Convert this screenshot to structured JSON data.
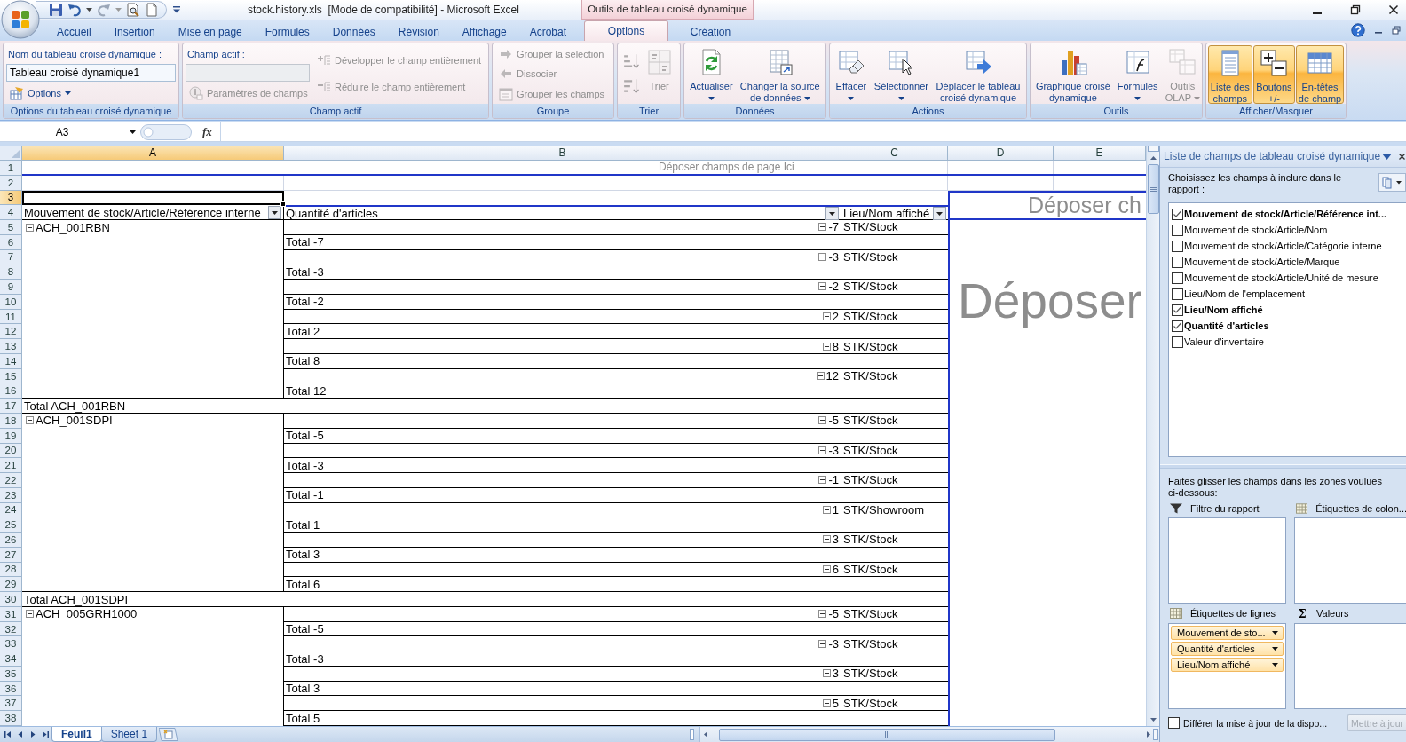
{
  "title_bar": {
    "title": "stock.history.xls  [Mode de compatibilité] - Microsoft Excel"
  },
  "ribbon_tabs": [
    {
      "label": "Accueil",
      "selected": false
    },
    {
      "label": "Insertion",
      "selected": false
    },
    {
      "label": "Mise en page",
      "selected": false
    },
    {
      "label": "Formules",
      "selected": false
    },
    {
      "label": "Données",
      "selected": false
    },
    {
      "label": "Révision",
      "selected": false
    },
    {
      "label": "Affichage",
      "selected": false
    },
    {
      "label": "Acrobat",
      "selected": false
    }
  ],
  "contextual_tabs": {
    "header": "Outils de tableau croisé dynamique",
    "tabs": [
      {
        "label": "Options",
        "selected": true
      },
      {
        "label": "Création",
        "selected": false
      }
    ]
  },
  "ribbon_groups": [
    {
      "label": "Options du tableau croisé dynamique",
      "columns": [
        [
          {
            "kind": "caption",
            "text": "Nom du tableau croisé dynamique :"
          },
          {
            "kind": "field",
            "value": "Tableau croisé dynamique1",
            "disabled": false
          },
          {
            "kind": "small",
            "label": "Options",
            "menu": true,
            "disabled": false
          }
        ]
      ]
    },
    {
      "label": "Champ actif",
      "columns": [
        [
          {
            "kind": "caption",
            "text": "Champ actif :"
          },
          {
            "kind": "field",
            "disabled": true
          },
          {
            "kind": "small",
            "label": "Paramètres de champs",
            "disabled": true
          }
        ],
        [
          {
            "kind": "small",
            "label": "Développer le champ entièrement",
            "disabled": true
          },
          {
            "kind": "small",
            "label": "Réduire le champ entièrement",
            "disabled": true
          }
        ]
      ]
    },
    {
      "label": "Groupe",
      "columns": [
        [
          {
            "kind": "small",
            "label": "Grouper la sélection",
            "disabled": true
          },
          {
            "kind": "small",
            "label": "Dissocier",
            "disabled": true
          },
          {
            "kind": "small",
            "label": "Grouper les champs",
            "disabled": true
          }
        ]
      ]
    },
    {
      "label": "Trier",
      "columns": [
        [
          {
            "kind": "icon",
            "disabled": true
          },
          {
            "kind": "icon",
            "disabled": true
          }
        ],
        [
          {
            "kind": "large",
            "label": "Trier",
            "disabled": true
          }
        ]
      ]
    },
    {
      "label": "Données",
      "columns": [
        [
          {
            "kind": "large",
            "label": "Actualiser",
            "menu": true,
            "disabled": false
          }
        ],
        [
          {
            "kind": "large",
            "label": "Changer la source\nde données",
            "menu": true,
            "disabled": false
          }
        ]
      ]
    },
    {
      "label": "Actions",
      "columns": [
        [
          {
            "kind": "large",
            "label": "Effacer",
            "menu": true,
            "disabled": false
          }
        ],
        [
          {
            "kind": "large",
            "label": "Sélectionner",
            "menu": true,
            "disabled": false
          }
        ],
        [
          {
            "kind": "large",
            "label": "Déplacer le tableau\ncroisé dynamique",
            "disabled": false
          }
        ]
      ]
    },
    {
      "label": "Outils",
      "columns": [
        [
          {
            "kind": "large",
            "label": "Graphique croisé\ndynamique",
            "disabled": false
          }
        ],
        [
          {
            "kind": "large",
            "label": "Formules",
            "menu": true,
            "disabled": false
          }
        ],
        [
          {
            "kind": "large",
            "label": "Outils\nOLAP",
            "menu": true,
            "disabled": true
          }
        ]
      ]
    },
    {
      "label": "Afficher/Masquer",
      "columns": [
        [
          {
            "kind": "toggle",
            "label": "Liste des\nchamps",
            "on": true
          }
        ],
        [
          {
            "kind": "toggle",
            "label": "Boutons\n+/-",
            "on": true
          }
        ],
        [
          {
            "kind": "toggle",
            "label": "En-têtes\nde champ",
            "on": true
          }
        ]
      ]
    }
  ],
  "formula_bar": {
    "name_box": "A3",
    "function_button": "fx"
  },
  "sheet": {
    "columns": [
      {
        "label": "A",
        "selected": true
      },
      {
        "label": "B",
        "selected": false
      },
      {
        "label": "C",
        "selected": false
      },
      {
        "label": "D",
        "selected": false
      },
      {
        "label": "E",
        "selected": false
      }
    ],
    "row_numbers": [
      {
        "label": "1",
        "selected": false
      },
      {
        "label": "2",
        "selected": false
      },
      {
        "label": "3",
        "selected": true
      },
      {
        "label": "4",
        "selected": false
      },
      {
        "label": "5",
        "selected": false
      },
      {
        "label": "6",
        "selected": false
      },
      {
        "label": "7",
        "selected": false
      },
      {
        "label": "8",
        "selected": false
      },
      {
        "label": "9",
        "selected": false
      },
      {
        "label": "10",
        "selected": false
      },
      {
        "label": "11",
        "selected": false
      },
      {
        "label": "12",
        "selected": false
      },
      {
        "label": "13",
        "selected": false
      },
      {
        "label": "14",
        "selected": false
      },
      {
        "label": "15",
        "selected": false
      },
      {
        "label": "16",
        "selected": false
      },
      {
        "label": "17",
        "selected": false
      },
      {
        "label": "18",
        "selected": false
      },
      {
        "label": "19",
        "selected": false
      },
      {
        "label": "20",
        "selected": false
      },
      {
        "label": "21",
        "selected": false
      },
      {
        "label": "22",
        "selected": false
      },
      {
        "label": "23",
        "selected": false
      },
      {
        "label": "24",
        "selected": false
      },
      {
        "label": "25",
        "selected": false
      },
      {
        "label": "26",
        "selected": false
      },
      {
        "label": "27",
        "selected": false
      },
      {
        "label": "28",
        "selected": false
      },
      {
        "label": "29",
        "selected": false
      },
      {
        "label": "30",
        "selected": false
      },
      {
        "label": "31",
        "selected": false
      },
      {
        "label": "32",
        "selected": false
      },
      {
        "label": "33",
        "selected": false
      },
      {
        "label": "34",
        "selected": false
      },
      {
        "label": "35",
        "selected": false
      },
      {
        "label": "36",
        "selected": false
      },
      {
        "label": "37",
        "selected": false
      },
      {
        "label": "38",
        "selected": false
      }
    ],
    "page_drop_zone": "Déposer champs de page Ici",
    "column_drop_zone": "Déposer ch",
    "data_drop_zone": "Déposer",
    "pivot": {
      "headers": [
        "Mouvement de stock/Article/Référence interne",
        "Quantité d'articles",
        "Lieu/Nom affiché"
      ],
      "groups": [
        {
          "label": "ACH_001RBN",
          "expanded": true,
          "quantities": [
            {
              "value": "-7",
              "expanded": true,
              "locations": [
                "STK/Stock"
              ],
              "total": "Total -7"
            },
            {
              "value": "-3",
              "expanded": true,
              "locations": [
                "STK/Stock"
              ],
              "total": "Total -3"
            },
            {
              "value": "-2",
              "expanded": true,
              "locations": [
                "STK/Stock"
              ],
              "total": "Total -2"
            },
            {
              "value": "2",
              "expanded": true,
              "locations": [
                "STK/Stock"
              ],
              "total": "Total 2"
            },
            {
              "value": "8",
              "expanded": true,
              "locations": [
                "STK/Stock"
              ],
              "total": "Total 8"
            },
            {
              "value": "12",
              "expanded": true,
              "locations": [
                "STK/Stock"
              ],
              "total": "Total 12"
            }
          ],
          "total": "Total ACH_001RBN"
        },
        {
          "label": "ACH_001SDPI",
          "expanded": true,
          "quantities": [
            {
              "value": "-5",
              "expanded": true,
              "locations": [
                "STK/Stock"
              ],
              "total": "Total -5"
            },
            {
              "value": "-3",
              "expanded": true,
              "locations": [
                "STK/Stock"
              ],
              "total": "Total -3"
            },
            {
              "value": "-1",
              "expanded": true,
              "locations": [
                "STK/Stock"
              ],
              "total": "Total -1"
            },
            {
              "value": "1",
              "expanded": true,
              "locations": [
                "STK/Showroom"
              ],
              "total": "Total 1"
            },
            {
              "value": "3",
              "expanded": true,
              "locations": [
                "STK/Stock"
              ],
              "total": "Total 3"
            },
            {
              "value": "6",
              "expanded": true,
              "locations": [
                "STK/Stock"
              ],
              "total": "Total 6"
            }
          ],
          "total": "Total ACH_001SDPI"
        },
        {
          "label": "ACH_005GRH1000",
          "expanded": true,
          "quantities": [
            {
              "value": "-5",
              "expanded": true,
              "locations": [
                "STK/Stock"
              ],
              "total": "Total -5"
            },
            {
              "value": "-3",
              "expanded": true,
              "locations": [
                "STK/Stock"
              ],
              "total": "Total -3"
            },
            {
              "value": "3",
              "expanded": true,
              "locations": [
                "STK/Stock"
              ],
              "total": "Total 3"
            },
            {
              "value": "5",
              "expanded": true,
              "locations": [
                "STK/Stock"
              ],
              "total": "Total 5"
            }
          ]
        }
      ]
    }
  },
  "sheet_tabs": [
    {
      "label": "Feuil1",
      "selected": true
    },
    {
      "label": "Sheet 1",
      "selected": false
    }
  ],
  "field_list": {
    "title": "Liste de champs de tableau croisé dynamique",
    "instructions": "Choisissez les champs à inclure dans le rapport :",
    "fields": [
      {
        "label": "Mouvement de stock/Article/Référence int...",
        "checked": true
      },
      {
        "label": "Mouvement de stock/Article/Nom",
        "checked": false
      },
      {
        "label": "Mouvement de stock/Article/Catégorie interne",
        "checked": false
      },
      {
        "label": "Mouvement de stock/Article/Marque",
        "checked": false
      },
      {
        "label": "Mouvement de stock/Article/Unité de mesure",
        "checked": false
      },
      {
        "label": "Lieu/Nom de l'emplacement",
        "checked": false
      },
      {
        "label": "Lieu/Nom affiché",
        "checked": true
      },
      {
        "label": "Quantité d'articles",
        "checked": true
      },
      {
        "label": "Valeur d'inventaire",
        "checked": false
      }
    ],
    "areas_instructions": "Faites glisser les champs dans les zones voulues ci-dessous:",
    "areas": [
      {
        "kind": "filter",
        "label": "Filtre du rapport"
      },
      {
        "kind": "columns",
        "label": "Étiquettes de colon..."
      },
      {
        "kind": "rows",
        "label": "Étiquettes de lignes",
        "fields": [
          "Mouvement de sto...",
          "Quantité d'articles",
          "Lieu/Nom affiché"
        ]
      },
      {
        "kind": "values",
        "label": "Valeurs",
        "symbol": "Σ"
      }
    ],
    "defer_update": {
      "label": "Différer la mise à jour de la dispo...",
      "checked": false
    },
    "update_button": {
      "label": "Mettre à jour",
      "disabled": true
    }
  }
}
